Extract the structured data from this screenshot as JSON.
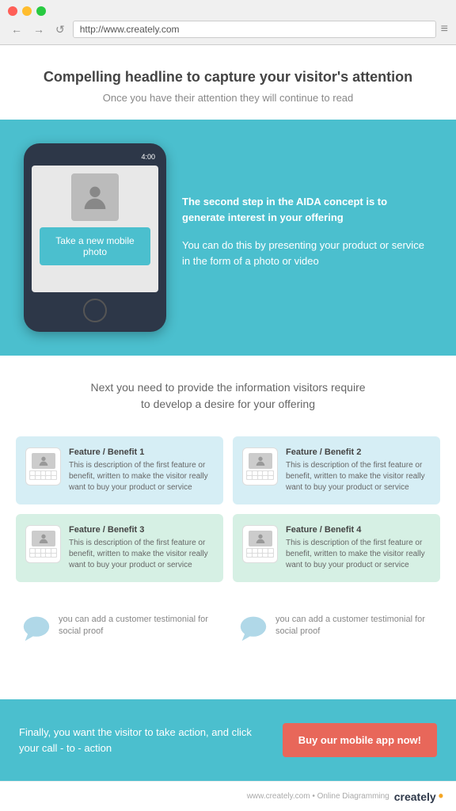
{
  "browser": {
    "url": "http://www.creately.com",
    "nav_back": "←",
    "nav_forward": "→",
    "nav_refresh": "↺",
    "menu": "≡"
  },
  "hero": {
    "headline": "Compelling headline to capture your visitor's attention",
    "subheadline": "Once you have their attention they will continue to read"
  },
  "aida": {
    "phone_time": "4:00",
    "cta_button": "Take a new mobile photo",
    "text1_bold": "The second step in the AIDA concept is to generate interest in your offering",
    "text2": "You can do this by presenting your product or service in the form of a photo or video"
  },
  "desire": {
    "text": "Next you need to provide the information visitors require to develop a desire for your offering"
  },
  "features": [
    {
      "title": "Feature / Benefit 1",
      "desc": "This is description of the first feature or benefit, written to make the visitor really want to buy your product or service",
      "color": "blue"
    },
    {
      "title": "Feature / Benefit 2",
      "desc": "This is description of the first feature or benefit, written to make the visitor really want to buy your product or service",
      "color": "blue"
    },
    {
      "title": "Feature / Benefit 3",
      "desc": "This is description of the first feature or benefit, written to make the visitor really want to buy your product or service",
      "color": "green"
    },
    {
      "title": "Feature / Benefit 4",
      "desc": "This is description of the first feature or benefit, written to make the visitor really want to buy your product or service",
      "color": "green"
    }
  ],
  "testimonials": [
    {
      "text": "you can add a customer testimonial for social proof"
    },
    {
      "text": "you can add a customer testimonial for social proof"
    }
  ],
  "cta_footer": {
    "text": "Finally, you want the visitor to take action, and click your call - to - action",
    "button": "Buy our mobile app now!"
  },
  "creately": {
    "footer_text": "www.creately.com • Online Diagramming",
    "logo_text": "creately"
  }
}
